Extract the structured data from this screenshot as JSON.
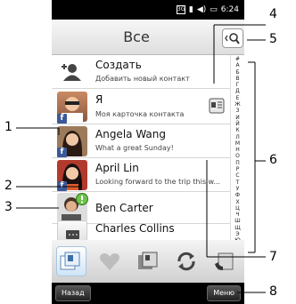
{
  "statusbar": {
    "network": "3G",
    "time": "6:24"
  },
  "header": {
    "title": "Все"
  },
  "contacts": [
    {
      "name": "Создать",
      "sub": "Добавить новый контакт"
    },
    {
      "name": "Я",
      "sub": "Моя карточка контакта"
    },
    {
      "name": "Angela Wang",
      "sub": "What a great Sunday!"
    },
    {
      "name": "April Lin",
      "sub": "Looking forward to the trip this w..."
    },
    {
      "name": "Ben Carter"
    },
    {
      "name": "Charles Collins"
    }
  ],
  "alphabet": [
    "#",
    "А",
    "Б",
    "В",
    "Г",
    "Д",
    "Е",
    "Ж",
    "З",
    "И",
    "Й",
    "К",
    "Л",
    "М",
    "Н",
    "О",
    "П",
    "Р",
    "С",
    "Т",
    "У",
    "Ф",
    "Х",
    "Ц",
    "Ч",
    "Ш",
    "Щ",
    "Э",
    "Ю",
    "Я"
  ],
  "softkeys": {
    "left": "Назад",
    "right": "Меню"
  },
  "callouts": [
    "1",
    "2",
    "3",
    "4",
    "5",
    "6",
    "7",
    "8"
  ]
}
